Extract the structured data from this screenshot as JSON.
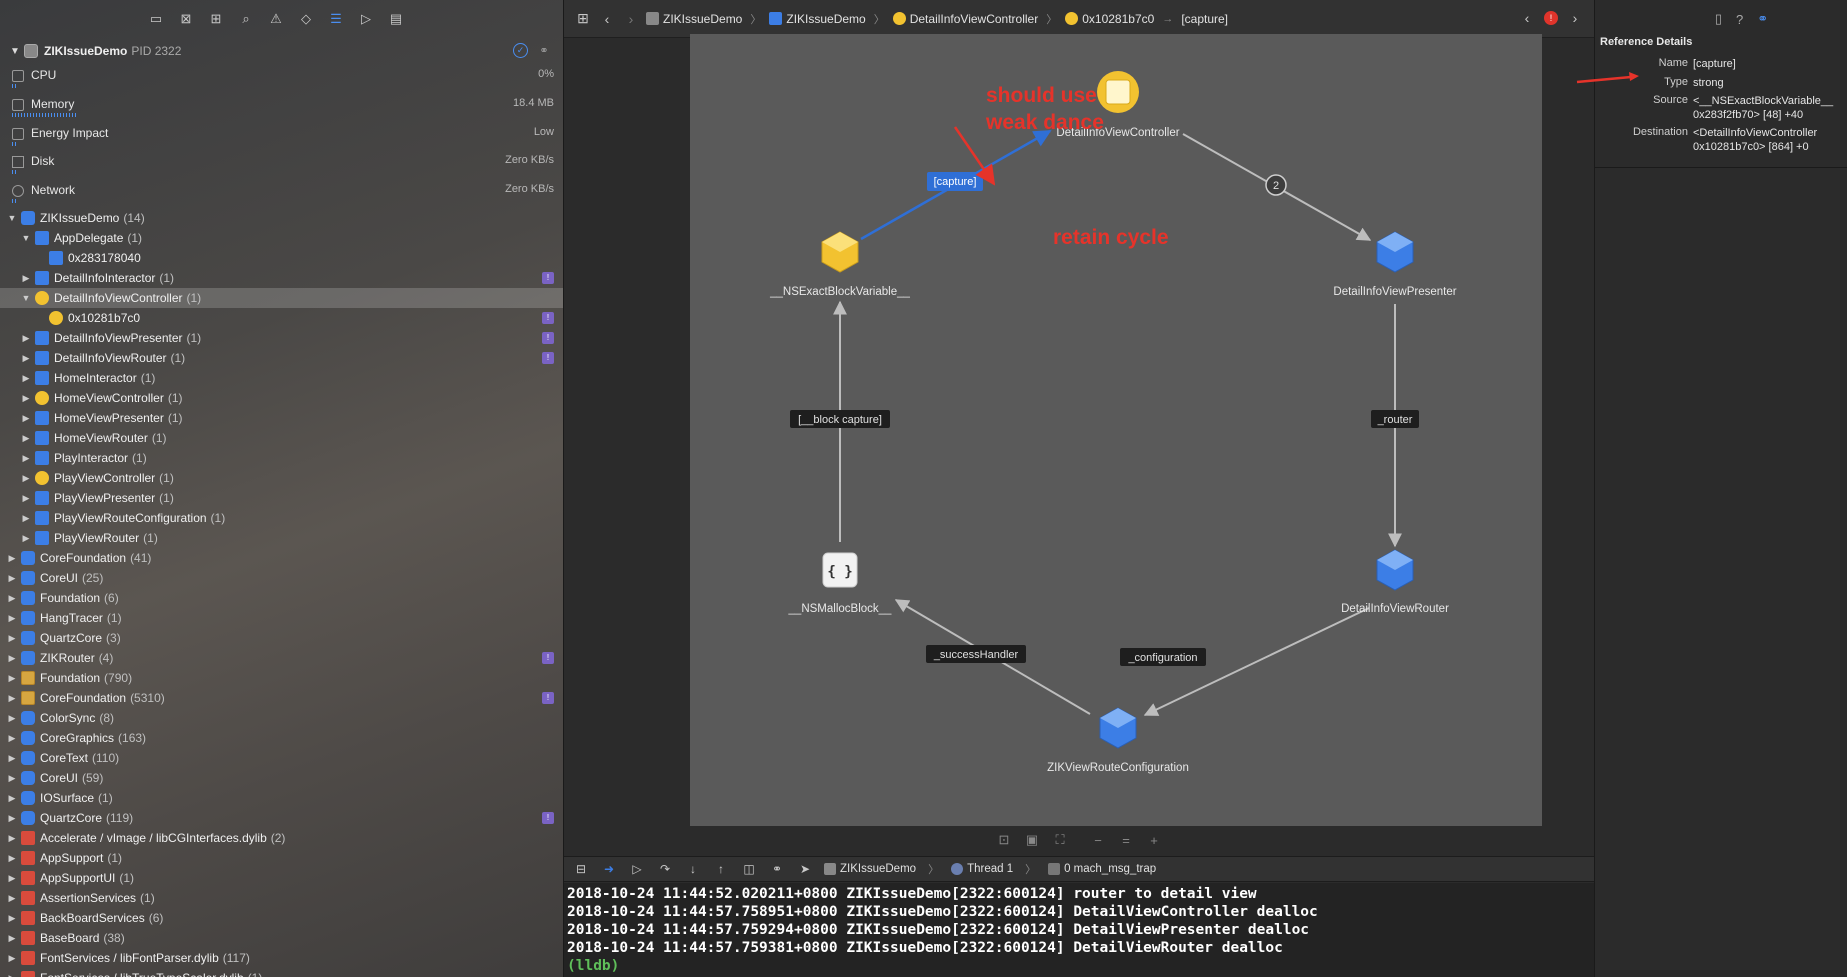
{
  "navigator": {
    "toolbar_icons": [
      "folder-icon",
      "source-control-icon",
      "symbol-icon",
      "search-icon",
      "warning-icon",
      "test-icon",
      "debug-icon",
      "breakpoint-icon",
      "report-icon"
    ],
    "process": {
      "name": "ZIKIssueDemo",
      "pid": "PID 2322"
    },
    "gauges": [
      {
        "label": "CPU",
        "value": "0%",
        "level": 0.0
      },
      {
        "label": "Memory",
        "value": "18.4 MB",
        "level": 0.12
      },
      {
        "label": "Energy Impact",
        "value": "Low",
        "level": 0.0
      },
      {
        "label": "Disk",
        "value": "Zero KB/s",
        "level": 0.0
      },
      {
        "label": "Network",
        "value": "Zero KB/s",
        "level": 0.0
      }
    ],
    "tree": [
      {
        "indent": 0,
        "tri": "open",
        "icon": "person",
        "name": "ZIKIssueDemo",
        "count": "(14)",
        "badge": false
      },
      {
        "indent": 1,
        "tri": "open",
        "icon": "cube",
        "name": "AppDelegate",
        "count": "(1)",
        "badge": false
      },
      {
        "indent": 2,
        "tri": "none",
        "icon": "cube",
        "name": "0x283178040",
        "count": "",
        "badge": false
      },
      {
        "indent": 1,
        "tri": "closed",
        "icon": "cube",
        "name": "DetailInfoInteractor",
        "count": "(1)",
        "badge": true
      },
      {
        "indent": 1,
        "tri": "open",
        "icon": "yellow",
        "name": "DetailInfoViewController",
        "count": "(1)",
        "badge": false,
        "selected": true
      },
      {
        "indent": 2,
        "tri": "none",
        "icon": "yellow",
        "name": "0x10281b7c0",
        "count": "",
        "badge": true
      },
      {
        "indent": 1,
        "tri": "closed",
        "icon": "cube",
        "name": "DetailInfoViewPresenter",
        "count": "(1)",
        "badge": true
      },
      {
        "indent": 1,
        "tri": "closed",
        "icon": "cube",
        "name": "DetailInfoViewRouter",
        "count": "(1)",
        "badge": true
      },
      {
        "indent": 1,
        "tri": "closed",
        "icon": "cube",
        "name": "HomeInteractor",
        "count": "(1)",
        "badge": false
      },
      {
        "indent": 1,
        "tri": "closed",
        "icon": "yellow",
        "name": "HomeViewController",
        "count": "(1)",
        "badge": false
      },
      {
        "indent": 1,
        "tri": "closed",
        "icon": "cube",
        "name": "HomeViewPresenter",
        "count": "(1)",
        "badge": false
      },
      {
        "indent": 1,
        "tri": "closed",
        "icon": "cube",
        "name": "HomeViewRouter",
        "count": "(1)",
        "badge": false
      },
      {
        "indent": 1,
        "tri": "closed",
        "icon": "cube",
        "name": "PlayInteractor",
        "count": "(1)",
        "badge": false
      },
      {
        "indent": 1,
        "tri": "closed",
        "icon": "yellow",
        "name": "PlayViewController",
        "count": "(1)",
        "badge": false
      },
      {
        "indent": 1,
        "tri": "closed",
        "icon": "cube",
        "name": "PlayViewPresenter",
        "count": "(1)",
        "badge": false
      },
      {
        "indent": 1,
        "tri": "closed",
        "icon": "cube",
        "name": "PlayViewRouteConfiguration",
        "count": "(1)",
        "badge": false
      },
      {
        "indent": 1,
        "tri": "closed",
        "icon": "cube",
        "name": "PlayViewRouter",
        "count": "(1)",
        "badge": false
      },
      {
        "indent": 0,
        "tri": "closed",
        "icon": "person",
        "name": "CoreFoundation",
        "count": "(41)",
        "badge": false
      },
      {
        "indent": 0,
        "tri": "closed",
        "icon": "person",
        "name": "CoreUI",
        "count": "(25)",
        "badge": false
      },
      {
        "indent": 0,
        "tri": "closed",
        "icon": "person",
        "name": "Foundation",
        "count": "(6)",
        "badge": false
      },
      {
        "indent": 0,
        "tri": "closed",
        "icon": "person",
        "name": "HangTracer",
        "count": "(1)",
        "badge": false
      },
      {
        "indent": 0,
        "tri": "closed",
        "icon": "person",
        "name": "QuartzCore",
        "count": "(3)",
        "badge": false
      },
      {
        "indent": 0,
        "tri": "closed",
        "icon": "person",
        "name": "ZIKRouter",
        "count": "(4)",
        "badge": true
      },
      {
        "indent": 0,
        "tri": "closed",
        "icon": "lib",
        "name": "Foundation",
        "count": "(790)",
        "badge": false
      },
      {
        "indent": 0,
        "tri": "closed",
        "icon": "lib",
        "name": "CoreFoundation",
        "count": "(5310)",
        "badge": true
      },
      {
        "indent": 0,
        "tri": "closed",
        "icon": "plug",
        "name": "ColorSync",
        "count": "(8)",
        "badge": false
      },
      {
        "indent": 0,
        "tri": "closed",
        "icon": "plug",
        "name": "CoreGraphics",
        "count": "(163)",
        "badge": false
      },
      {
        "indent": 0,
        "tri": "closed",
        "icon": "plug",
        "name": "CoreText",
        "count": "(110)",
        "badge": false
      },
      {
        "indent": 0,
        "tri": "closed",
        "icon": "plug",
        "name": "CoreUI",
        "count": "(59)",
        "badge": false
      },
      {
        "indent": 0,
        "tri": "closed",
        "icon": "plug",
        "name": "IOSurface",
        "count": "(1)",
        "badge": false
      },
      {
        "indent": 0,
        "tri": "closed",
        "icon": "plug",
        "name": "QuartzCore",
        "count": "(119)",
        "badge": true
      },
      {
        "indent": 0,
        "tri": "closed",
        "icon": "red",
        "name": "Accelerate / vImage / libCGInterfaces.dylib",
        "count": "(2)",
        "badge": false
      },
      {
        "indent": 0,
        "tri": "closed",
        "icon": "red",
        "name": "AppSupport",
        "count": "(1)",
        "badge": false
      },
      {
        "indent": 0,
        "tri": "closed",
        "icon": "red",
        "name": "AppSupportUI",
        "count": "(1)",
        "badge": false
      },
      {
        "indent": 0,
        "tri": "closed",
        "icon": "red",
        "name": "AssertionServices",
        "count": "(1)",
        "badge": false
      },
      {
        "indent": 0,
        "tri": "closed",
        "icon": "red",
        "name": "BackBoardServices",
        "count": "(6)",
        "badge": false
      },
      {
        "indent": 0,
        "tri": "closed",
        "icon": "red",
        "name": "BaseBoard",
        "count": "(38)",
        "badge": false
      },
      {
        "indent": 0,
        "tri": "closed",
        "icon": "red",
        "name": "FontServices / libFontParser.dylib",
        "count": "(117)",
        "badge": false
      },
      {
        "indent": 0,
        "tri": "closed",
        "icon": "red",
        "name": "FontServices / libTrueTypeScaler.dylib",
        "count": "(1)",
        "badge": false
      }
    ]
  },
  "jumpbar": {
    "crumbs": [
      "ZIKIssueDemo",
      "ZIKIssueDemo",
      "DetailInfoViewController",
      "0x10281b7c0",
      "[capture]"
    ],
    "error_count": "!"
  },
  "graph": {
    "nodes": {
      "root": "DetailInfoViewController",
      "block_var": "__NSExactBlockVariable__",
      "presenter": "DetailInfoViewPresenter",
      "malloc_block": "__NSMallocBlock__",
      "router": "DetailInfoViewRouter",
      "route_config": "ZIKViewRouteConfiguration",
      "malloc_glyph": "{ }"
    },
    "edges": {
      "capture": "[capture]",
      "count_badge": "2",
      "block_capture": "[__block capture]",
      "router": "_router",
      "success_handler": "_successHandler",
      "configuration": "_configuration"
    },
    "annotations": {
      "weak_line1": "should use",
      "weak_line2": "weak dance",
      "cycle": "retain cycle"
    },
    "colors": {
      "annotation": "#e6332a",
      "selected_edge": "#2f6fd6",
      "node_blue": "#3c7ee6",
      "node_yellow": "#f2c230"
    }
  },
  "debug_bar": {
    "crumbs": [
      "ZIKIssueDemo",
      "Thread 1",
      "0 mach_msg_trap"
    ]
  },
  "console": {
    "lines": [
      "2018-10-24 11:44:52.020211+0800 ZIKIssueDemo[2322:600124] router to detail view",
      "2018-10-24 11:44:57.758951+0800 ZIKIssueDemo[2322:600124] DetailViewController dealloc",
      "2018-10-24 11:44:57.759294+0800 ZIKIssueDemo[2322:600124] DetailViewPresenter dealloc",
      "2018-10-24 11:44:57.759381+0800 ZIKIssueDemo[2322:600124] DetailViewRouter dealloc"
    ],
    "prompt": "(lldb)"
  },
  "inspector": {
    "title": "Reference Details",
    "rows": [
      {
        "key": "Name",
        "value": [
          "[capture]"
        ]
      },
      {
        "key": "Type",
        "value": [
          "strong"
        ]
      },
      {
        "key": "Source",
        "value": [
          "<__NSExactBlockVariable__",
          "0x283f2fb70> [48] +40"
        ]
      },
      {
        "key": "Destination",
        "value": [
          "<DetailInfoViewController",
          "0x10281b7c0> [864] +0"
        ]
      }
    ]
  }
}
